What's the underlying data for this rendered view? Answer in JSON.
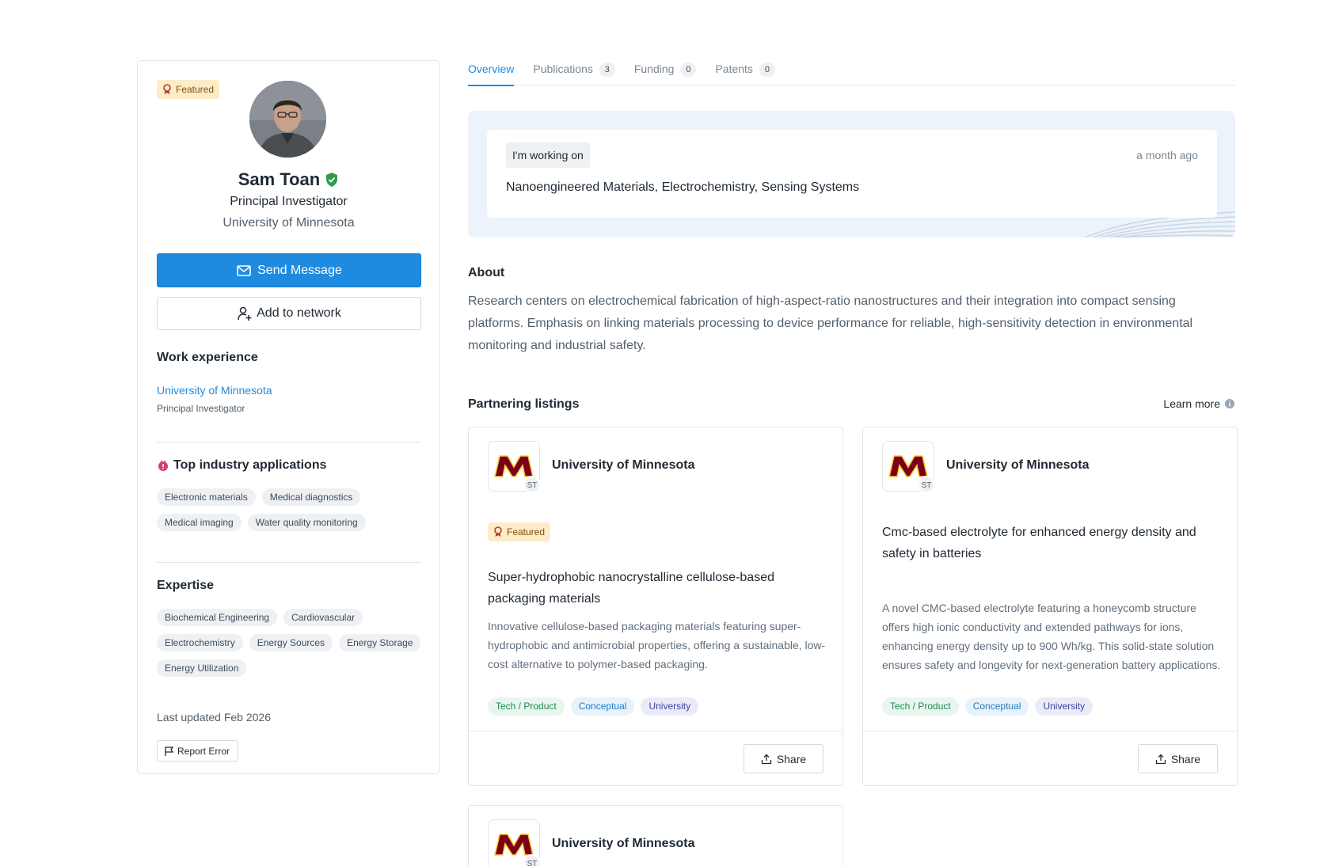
{
  "profile": {
    "featured_label": "Featured",
    "name": "Sam Toan",
    "title": "Principal Investigator",
    "organization": "University of Minnesota",
    "send_message_label": "Send Message",
    "add_network_label": "Add to network",
    "work_experience": {
      "heading": "Work experience",
      "org": "University of Minnesota",
      "role": "Principal Investigator"
    },
    "industry": {
      "heading": "Top industry applications",
      "chips": [
        "Electronic materials",
        "Medical diagnostics",
        "Medical imaging",
        "Water quality monitoring"
      ]
    },
    "expertise": {
      "heading": "Expertise",
      "chips": [
        "Biochemical Engineering",
        "Cardiovascular",
        "Electrochemistry",
        "Energy Sources",
        "Energy Storage",
        "Energy Utilization"
      ]
    },
    "last_updated": "Last updated Feb 2026",
    "report_error_label": "Report Error"
  },
  "tabs": [
    {
      "label": "Overview",
      "count": ""
    },
    {
      "label": "Publications",
      "count": "3"
    },
    {
      "label": "Funding",
      "count": "0"
    },
    {
      "label": "Patents",
      "count": "0"
    }
  ],
  "working_on": {
    "tag": "I'm working on",
    "time": "a month ago",
    "text": "Nanoengineered Materials, Electrochemistry, Sensing Systems"
  },
  "about": {
    "heading": "About",
    "text": "Research centers on electrochemical fabrication of high-aspect-ratio nanostructures and their integration into compact sensing platforms. Emphasis on linking materials processing to device performance for reliable, high-sensitivity detection in environmental monitoring and industrial safety."
  },
  "partnering": {
    "heading": "Partnering listings",
    "learn_more": "Learn more",
    "listings": [
      {
        "org": "University of Minnesota",
        "org_badge": "ST",
        "featured_label": "Featured",
        "title": "Super-hydrophobic nanocrystalline cellulose-based packaging materials",
        "description": "Innovative cellulose-based packaging materials featuring super-hydrophobic and antimicrobial properties, offering a sustainable, low-cost alternative to polymer-based packaging.",
        "tags": [
          "Tech / Product",
          "Conceptual",
          "University"
        ],
        "share_label": "Share"
      },
      {
        "org": "University of Minnesota",
        "org_badge": "ST",
        "title": "Cmc-based electrolyte for enhanced energy density and safety in batteries",
        "description": "A novel CMC-based electrolyte featuring a honeycomb structure offers high ionic conductivity and extended pathways for ions, enhancing energy density up to 900 Wh/kg. This solid-state solution ensures safety and longevity for next-generation battery applications.",
        "tags": [
          "Tech / Product",
          "Conceptual",
          "University"
        ],
        "share_label": "Share"
      },
      {
        "org": "University of Minnesota",
        "org_badge": "ST"
      }
    ]
  },
  "colors": {
    "accent": "#1f8be0",
    "featured_bg": "#fdecc8",
    "verified": "#2e9b4f",
    "umn_maroon": "#7a0019",
    "umn_gold": "#ffcc33"
  }
}
